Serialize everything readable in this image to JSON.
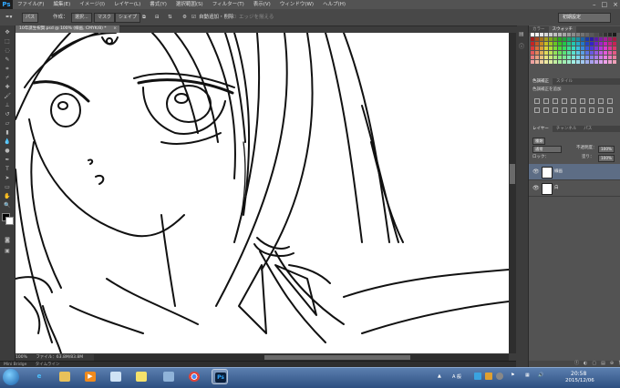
{
  "menubar": {
    "app": "Ps",
    "items": [
      "ファイル(F)",
      "編集(E)",
      "イメージ(I)",
      "レイヤー(L)",
      "書式(Y)",
      "選択範囲(S)",
      "フィルター(T)",
      "表示(V)",
      "ウィンドウ(W)",
      "ヘルプ(H)"
    ],
    "window_controls": [
      "–",
      "□",
      "×"
    ]
  },
  "options": {
    "preset": "パス",
    "make_label": "作成：",
    "select_btn": "選択...",
    "mask_btn": "マスク",
    "shape_btn": "シェイプ",
    "auto_add_delete": "自動追加・削除",
    "align_edges": "エッジを揃える",
    "workspace": "初期設定"
  },
  "document": {
    "tab_title": "10年誕生祝賀.psd @ 100% (線画, CMYK/8) *",
    "zoom": "100%",
    "file_info": "ファイル：63.8M/83.8M"
  },
  "minibridge": {
    "tabs": [
      "Mini Bridge",
      "タイムライン"
    ]
  },
  "panels": {
    "swatch_tabs": [
      "カラー",
      "スウォッチ"
    ],
    "adjust_tabs": [
      "色調補正",
      "スタイル"
    ],
    "adjust_title": "色調補正を追加",
    "layer_tabs": [
      "レイヤー",
      "チャンネル",
      "パス"
    ],
    "kind": "種類",
    "blend_mode": "通常",
    "opacity_label": "不透明度：",
    "opacity": "100%",
    "lock_label": "ロック：",
    "fill_label": "塗り：",
    "fill": "100%",
    "layers": [
      {
        "name": "線画",
        "selected": true
      },
      {
        "name": "白",
        "selected": false
      }
    ],
    "bottom_icons": [
      "ⓕ",
      "◐",
      "▢",
      "▤",
      "⊕",
      "🗑"
    ]
  },
  "taskbar": {
    "apps": [
      "windows-start",
      "ie",
      "explorer",
      "media-player",
      "paint",
      "sticky",
      "chrome",
      "photoshop"
    ],
    "ps_label": "Ps",
    "ime": "A 般",
    "time": "20:58",
    "date": "2015/12/06"
  },
  "colors": {
    "ui_dark": "#3c3c3c",
    "ui_mid": "#535353",
    "selected_layer": "#5d6d85",
    "taskbar_top": "#5b7fb0",
    "taskbar_bottom": "#2d4f80",
    "canvas": "#ffffff"
  }
}
